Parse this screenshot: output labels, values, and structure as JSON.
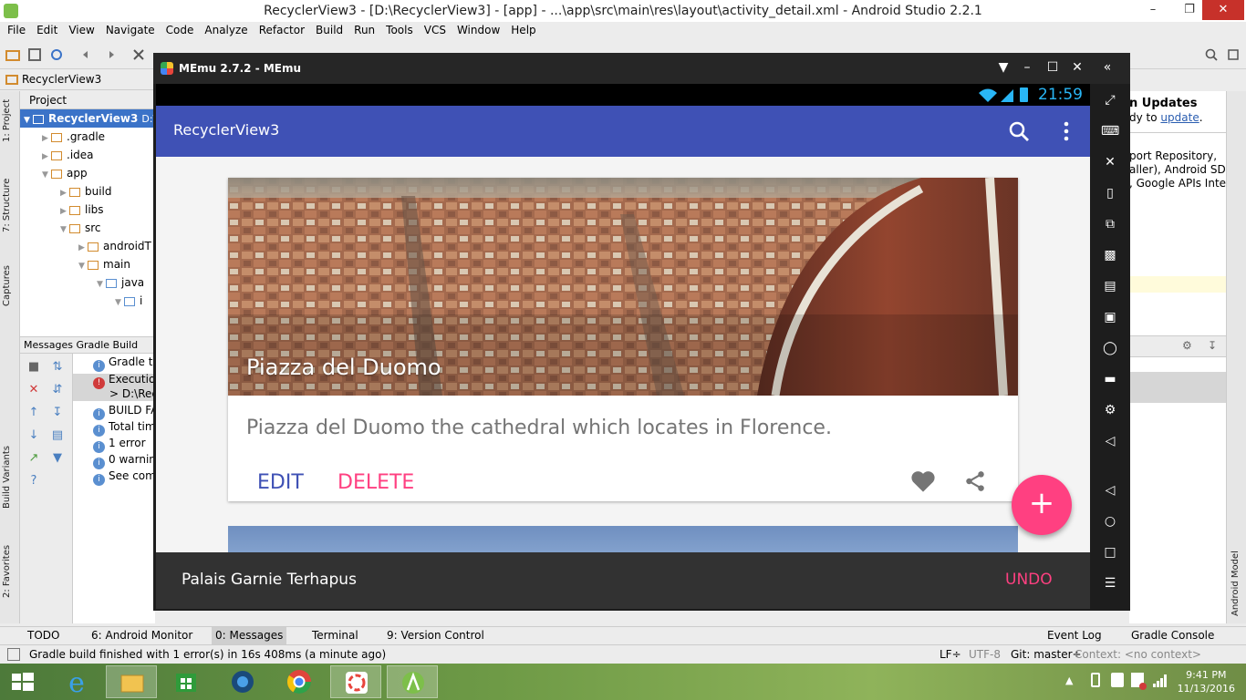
{
  "window": {
    "title": "RecyclerView3 - [D:\\RecyclerView3] - [app] - ...\\app\\src\\main\\res\\layout\\activity_detail.xml - Android Studio 2.2.1",
    "minimize": "–",
    "restore": "❐",
    "close": "✕"
  },
  "menu": [
    "File",
    "Edit",
    "View",
    "Navigate",
    "Code",
    "Analyze",
    "Refactor",
    "Build",
    "Run",
    "Tools",
    "VCS",
    "Window",
    "Help"
  ],
  "breadcrumb": "RecyclerView3",
  "left_tabs": [
    "1: Project",
    "7: Structure",
    "Captures",
    "Build Variants",
    "2: Favorites"
  ],
  "project": {
    "header": "Project",
    "rows": [
      {
        "label": "RecyclerView3",
        "suffix": "D:\\",
        "indent": 0,
        "selected": true
      },
      {
        "label": ".gradle",
        "indent": 1
      },
      {
        "label": ".idea",
        "indent": 1
      },
      {
        "label": "app",
        "indent": 1
      },
      {
        "label": "build",
        "indent": 2
      },
      {
        "label": "libs",
        "indent": 2
      },
      {
        "label": "src",
        "indent": 2
      },
      {
        "label": "androidT",
        "indent": 3
      },
      {
        "label": "main",
        "indent": 3
      },
      {
        "label": "java",
        "indent": 4
      },
      {
        "label": "i",
        "indent": 5
      }
    ]
  },
  "messages": {
    "header": "Messages Gradle Build",
    "rows": [
      {
        "text": "Gradle ta",
        "type": "info"
      },
      {
        "text": "Execution",
        "type": "error"
      },
      {
        "text": "> D:\\Rec",
        "type": "none"
      },
      {
        "text": "BUILD FA",
        "type": "info"
      },
      {
        "text": "Total tim",
        "type": "info"
      },
      {
        "text": "1 error",
        "type": "info"
      },
      {
        "text": "0 warnin",
        "type": "info"
      },
      {
        "text": "See com",
        "type": "info"
      }
    ]
  },
  "right_panel": {
    "title": "n Updates",
    "line1": "dy to",
    "link": "update",
    "body": [
      "port Repository,",
      "aller), Android SDK",
      ", Google APIs Intel"
    ]
  },
  "right_tab": "Android Model",
  "bottom_tabs": [
    "TODO",
    "6: Android Monitor",
    "0: Messages",
    "Terminal",
    "9: Version Control",
    "Event Log",
    "Gradle Console"
  ],
  "status": {
    "message": "Gradle build finished with 1 error(s) in 16s 408ms (a minute ago)",
    "lf": "LF÷",
    "encoding": "UTF-8",
    "git": "Git: master÷",
    "context": "Context: <no context>"
  },
  "memu": {
    "title": "MEmu 2.7.2 - MEmu",
    "time": "21:59"
  },
  "app": {
    "title": "RecyclerView3",
    "card": {
      "title": "Piazza del Duomo",
      "description": "Piazza del Duomo the cathedral which locates in Florence.",
      "edit": "EDIT",
      "delete": "DELETE"
    },
    "snackbar": {
      "message": "Palais Garnie Terhapus",
      "action": "UNDO"
    },
    "fab": "+"
  },
  "taskbar": {
    "time": "9:41 PM",
    "date": "11/13/2016"
  },
  "colors": {
    "primary": "#3f51b5",
    "accent": "#ff4081",
    "snackbar": "#323232"
  }
}
